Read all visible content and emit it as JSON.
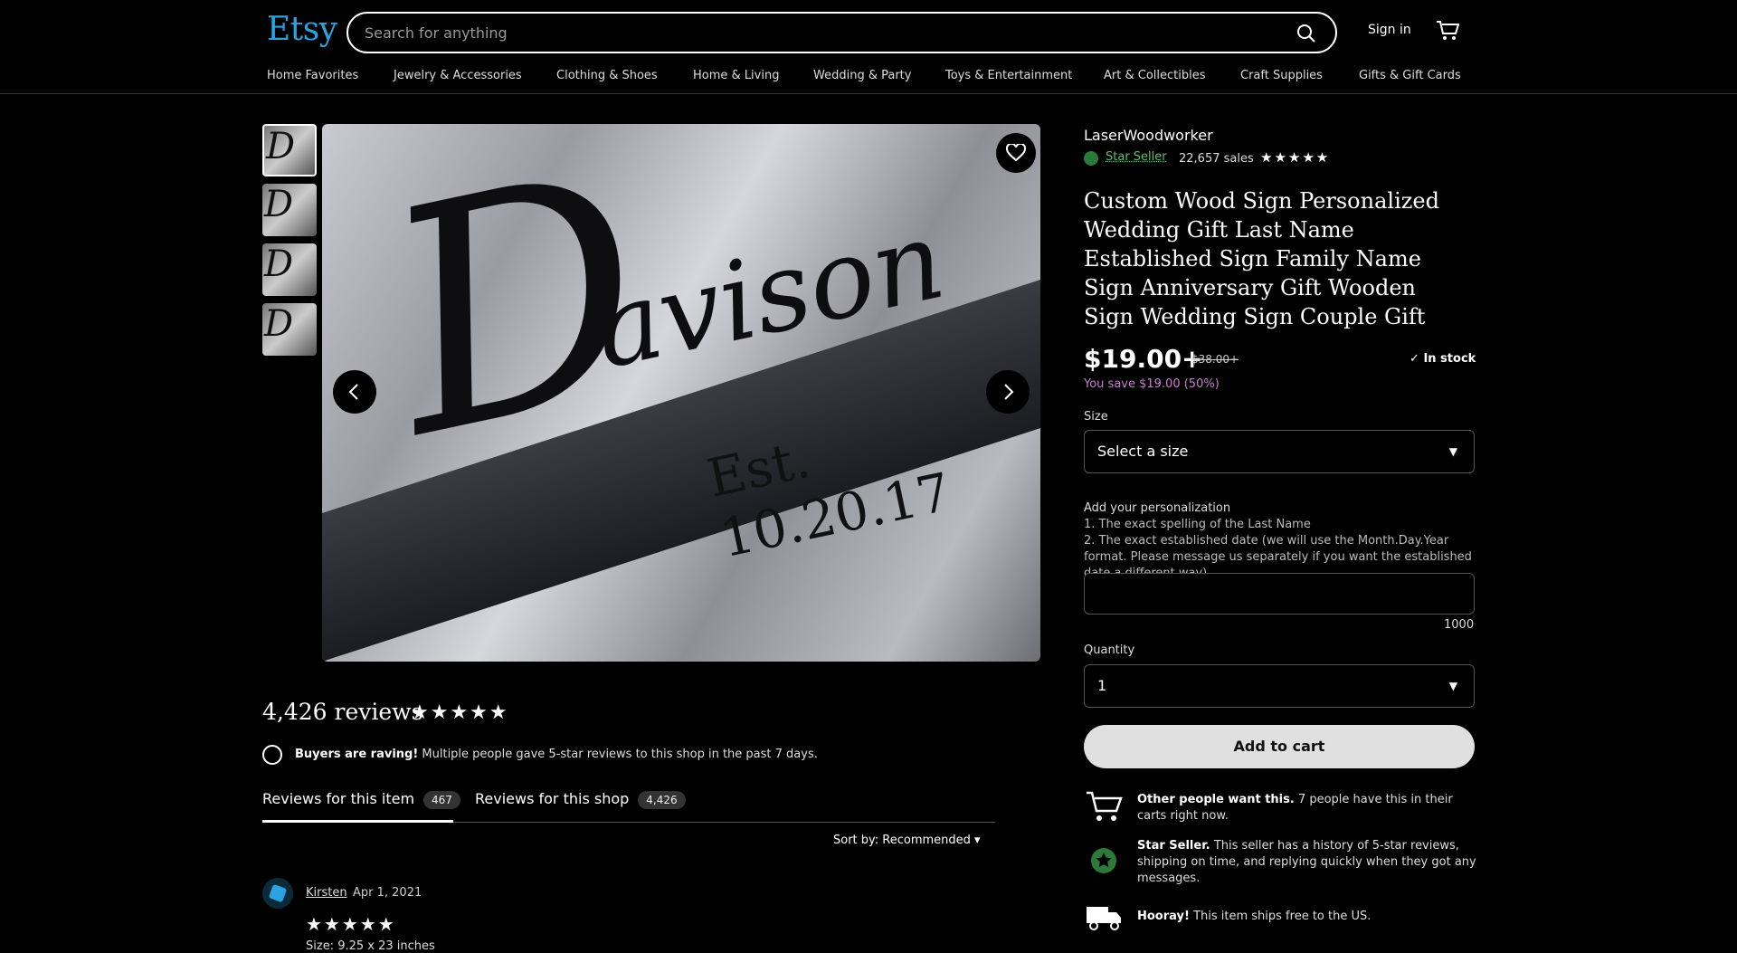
{
  "header": {
    "logo": "Etsy",
    "search_placeholder": "Search for anything",
    "sign_in": "Sign in",
    "nav": [
      "Home Favorites",
      "Jewelry & Accessories",
      "Clothing & Shoes",
      "Home & Living",
      "Wedding & Party",
      "Toys & Entertainment",
      "Art & Collectibles",
      "Craft Supplies",
      "Gifts & Gift Cards"
    ]
  },
  "gallery": {
    "image_text": {
      "letter": "D",
      "name": "avison",
      "est": "Est. 10.20.17"
    },
    "thumbnail_count": 4,
    "active_thumbnail": 1
  },
  "reviews": {
    "title": "4,426 reviews",
    "rating_stars": "★★★★★",
    "raving_bold": "Buyers are raving!",
    "raving_text": "Multiple people gave 5-star reviews to this shop in the past 7 days.",
    "tab_item_label": "Reviews for this item",
    "tab_item_count": "467",
    "tab_shop_label": "Reviews for this shop",
    "tab_shop_count": "4,426",
    "sort_label": "Sort by: Recommended",
    "first_review": {
      "name": "Kirsten",
      "date": "Apr 1, 2021",
      "stars": "★★★★★",
      "size_label": "Size:",
      "size_value": "9.25 x 23 inches"
    }
  },
  "listing": {
    "shop_name": "LaserWoodworker",
    "star_seller": "Star Seller",
    "sales": "22,657 sales",
    "shop_stars": "★★★★★",
    "title": "Custom Wood Sign Personalized Wedding Gift Last Name Established Sign Family Name Sign Anniversary Gift Wooden Sign Wedding Sign Couple Gift",
    "price": "$19.00+",
    "old_price": "$38.00+",
    "in_stock": "In stock",
    "savings": "You save $19.00 (50%)",
    "size_label": "Size",
    "size_value": "Select a size",
    "personalization_label": "Add your personalization",
    "personalization_line1": "1. The exact spelling of the Last Name",
    "personalization_line2": "2. The exact established date (we will use the Month.Day.Year format. Please message us separately if you want the established date a different way)",
    "char_counter": "1000",
    "quantity_label": "Quantity",
    "quantity_value": "1",
    "add_to_cart": "Add to cart",
    "features": [
      {
        "bold": "Other people want this.",
        "text": "7 people have this in their carts right now."
      },
      {
        "bold": "Star Seller.",
        "text": "This seller has a history of 5-star reviews, shipping on time, and replying quickly when they got any messages."
      },
      {
        "bold": "Hooray!",
        "text": "This item ships free to the US."
      }
    ]
  },
  "colors": {
    "background": "#000000",
    "logo": "#2ba3e0",
    "star_seller": "#5fbf6f",
    "savings": "#c97fd0"
  }
}
